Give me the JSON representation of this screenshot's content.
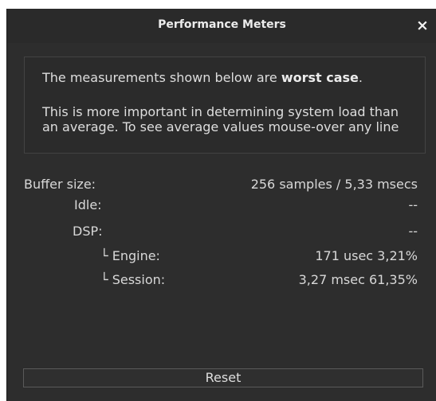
{
  "window": {
    "title": "Performance Meters",
    "close_icon": "×"
  },
  "note": {
    "line1_prefix": "The measurements shown below are ",
    "line1_bold": "worst case",
    "line1_suffix": ".",
    "paragraph": "This is more important in determining system load than an average. To see average values mouse-over any line"
  },
  "metrics": {
    "buffer_size": {
      "label": "Buffer size:",
      "value": "256 samples /  5,33 msecs"
    },
    "idle": {
      "label": "Idle:",
      "value": "--"
    },
    "dsp": {
      "label": "DSP:",
      "value": "--"
    },
    "engine": {
      "label": "└ Engine:",
      "value": "171 usec  3,21%"
    },
    "session": {
      "label": "└ Session:",
      "value": "3,27 msec 61,35%"
    }
  },
  "reset_button": {
    "label": "Reset"
  }
}
